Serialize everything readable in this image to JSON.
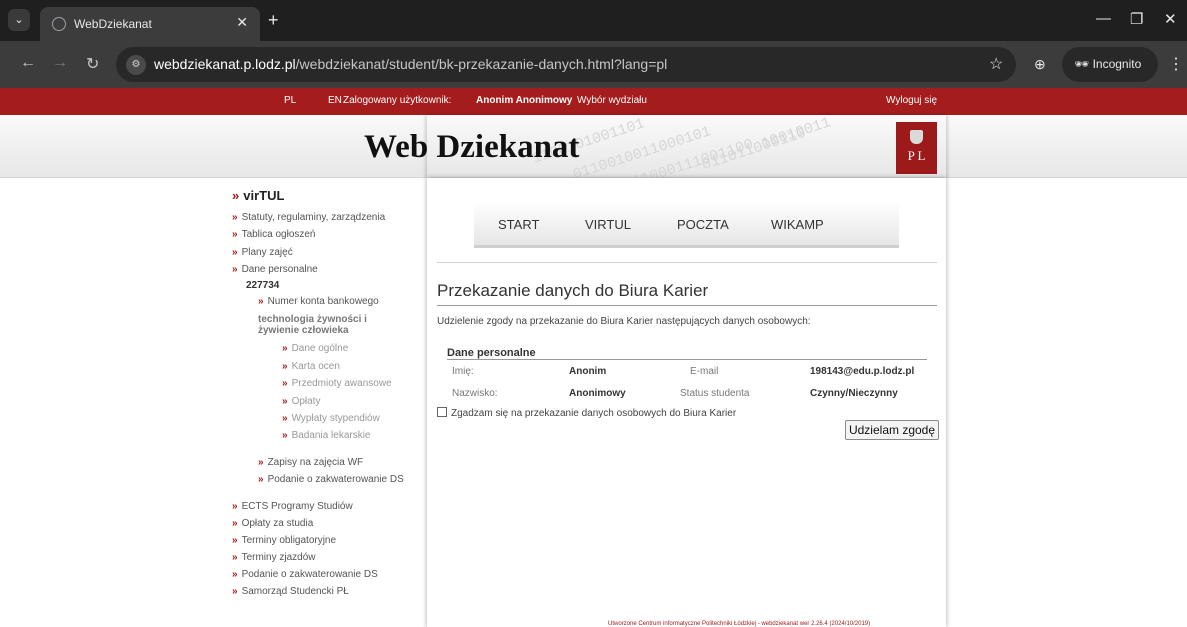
{
  "browser": {
    "tab_title": "WebDziekanat",
    "url_host": "webdziekanat.p.lodz.pl",
    "url_path": "/webdziekanat/student/bk-przekazanie-danych.html?lang=pl",
    "incognito_label": "Incognito"
  },
  "topbar": {
    "lang_pl": "PL",
    "lang_en": "EN",
    "logged_label": "Zalogowany użytkownik:",
    "user_name": "Anonim Anonimowy",
    "faculty_link": "Wybór wydziału",
    "logout": "Wyloguj się"
  },
  "header": {
    "logo_text": "Web Dziekanat",
    "pl_logo": "P L"
  },
  "main_nav": [
    "START",
    "VIRTUL",
    "POCZTA",
    "WIKAMP"
  ],
  "form": {
    "title": "Przekazanie danych do Biura Karier",
    "intro": "Udzielenie zgody na przekazanie do Biura Karier następujących danych osobowych:",
    "section_heading": "Dane personalne",
    "first_name_label": "Imię:",
    "first_name_value": "Anonim",
    "last_name_label": "Nazwisko:",
    "last_name_value": "Anonimowy",
    "email_label": "E-mail",
    "email_value": "198143@edu.p.lodz.pl",
    "status_label": "Status studenta",
    "status_value": "Czynny/Nieczynny",
    "consent_label": "Zgadzam się na przekazanie danych osobowych do Biura Karier",
    "consent_checked": false,
    "submit_label": "Udzielam zgodę"
  },
  "sidemenu": {
    "virtul": "virTUL",
    "statutes": "Statuty, regulaminy, zarządzenia",
    "notices": "Tablica ogłoszeń",
    "schedules": "Plany zajęć",
    "personal": "Dane personalne",
    "student_id": "227734",
    "bank_account": "Numer konta bankowego",
    "field_of_study": "technologia żywności i żywienie człowieka",
    "general": "Dane ogólne",
    "grades": "Karta ocen",
    "advanced": "Przedmioty awansowe",
    "fees": "Opłaty",
    "scholarships": "Wypłaty stypendiów",
    "medical": "Badania lekarskie",
    "pe_signup": "Zapisy na zajęcia WF",
    "dorm_application_1": "Podanie o zakwaterowanie DS",
    "ects": "ECTS Programy Studiów",
    "tuition": "Opłaty za studia",
    "deadlines": "Terminy obligatoryjne",
    "reunions": "Terminy zjazdów",
    "dorm_application_2": "Podanie o zakwaterowanie DS",
    "student_gov": "Samorząd Studencki PŁ"
  },
  "footer": "Utworzone Centrum informatyczne Politechniki Łódzkiej - webdziekanat wer 2.26.4 (2024/10/2019)"
}
